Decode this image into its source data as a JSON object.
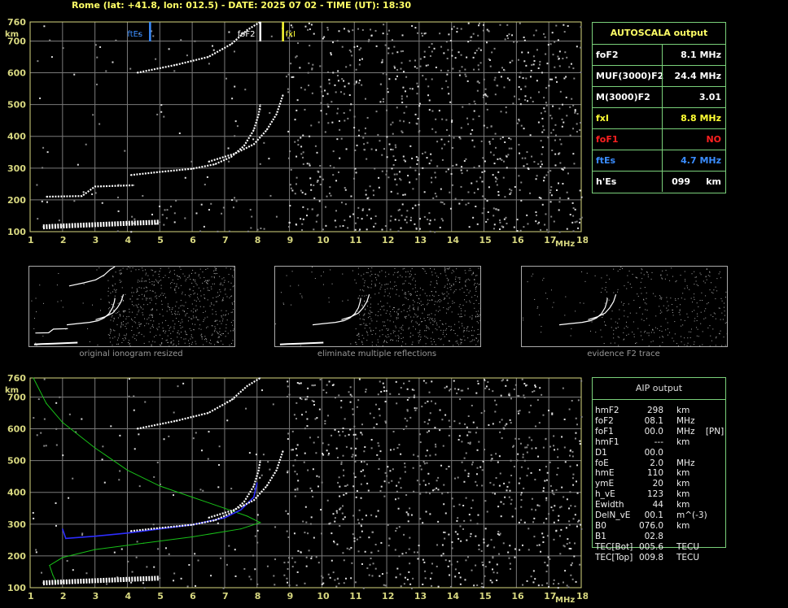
{
  "header": "Rome (lat: +41.8, lon: 012.5) - DATE: 2025 07 02 - TIME (UT): 18:30",
  "colors": {
    "grid": "#7a7a7a",
    "axis": "#d8d880",
    "trace": "#ffffff",
    "profile": "#18c018",
    "true_height": "#2d2dff",
    "fxI": "#ffff33",
    "ftEs": "#3a8dff",
    "foF1": "#ff2020",
    "table_border": "#7ad07a"
  },
  "chart_data": [
    {
      "type": "scatter",
      "title": "",
      "xlabel": "MHz",
      "ylabel": "km",
      "xlim": [
        1,
        18
      ],
      "ylim": [
        100,
        760
      ],
      "x_ticks": [
        "1",
        "2",
        "3",
        "4",
        "5",
        "6",
        "7",
        "8",
        "9",
        "10",
        "11",
        "12",
        "13",
        "14",
        "15",
        "16",
        "17",
        "18"
      ],
      "y_ticks": [
        "100",
        "200",
        "300",
        "400",
        "500",
        "600",
        "700",
        "760"
      ],
      "grid": true,
      "markers": [
        {
          "label": "ftEs",
          "x": 4.7,
          "color": "#3a8dff"
        },
        {
          "label": "foF2",
          "x": 8.1,
          "color": "#ffffff"
        },
        {
          "label": "fxI",
          "x": 8.8,
          "color": "#ffff33"
        }
      ],
      "series": [
        {
          "name": "",
          "role": "Es trace",
          "points": [
            [
              1.4,
              115
            ],
            [
              2,
              118
            ],
            [
              3,
              122
            ],
            [
              4,
              126
            ],
            [
              5,
              130
            ]
          ]
        },
        {
          "name": "",
          "role": "Es 2nd hop",
          "points": [
            [
              1.5,
              210
            ],
            [
              2.6,
              212
            ],
            [
              3,
              242
            ],
            [
              4.2,
              246
            ]
          ]
        },
        {
          "name": "",
          "role": "F2 ordinary",
          "points": [
            [
              4.1,
              278
            ],
            [
              5,
              288
            ],
            [
              6,
              298
            ],
            [
              6.7,
              312
            ],
            [
              7.2,
              335
            ],
            [
              7.6,
              370
            ],
            [
              7.9,
              420
            ],
            [
              8.05,
              470
            ],
            [
              8.1,
              500
            ]
          ]
        },
        {
          "name": "",
          "role": "F2 extraordinary",
          "points": [
            [
              6.5,
              320
            ],
            [
              7.3,
              345
            ],
            [
              7.9,
              375
            ],
            [
              8.3,
              420
            ],
            [
              8.6,
              470
            ],
            [
              8.8,
              530
            ]
          ]
        },
        {
          "name": "",
          "role": "F2 2nd hop",
          "points": [
            [
              4.3,
              600
            ],
            [
              5.5,
              625
            ],
            [
              6.5,
              650
            ],
            [
              7.2,
              690
            ],
            [
              7.7,
              735
            ],
            [
              8.1,
              760
            ]
          ]
        }
      ]
    },
    {
      "type": "line",
      "title": "",
      "xlabel": "MHz",
      "ylabel": "km",
      "xlim": [
        1,
        18
      ],
      "ylim": [
        100,
        760
      ],
      "x_ticks": [
        "1",
        "2",
        "3",
        "4",
        "5",
        "6",
        "7",
        "8",
        "9",
        "10",
        "11",
        "12",
        "13",
        "14",
        "15",
        "16",
        "17",
        "18"
      ],
      "y_ticks": [
        "100",
        "200",
        "300",
        "400",
        "500",
        "600",
        "700",
        "760"
      ],
      "grid": true,
      "series": [
        {
          "name": "",
          "role": "electron density profile",
          "points": [
            [
              1.1,
              760
            ],
            [
              1.5,
              680
            ],
            [
              2,
              620
            ],
            [
              3,
              540
            ],
            [
              4,
              470
            ],
            [
              5,
              420
            ],
            [
              6,
              385
            ],
            [
              7,
              350
            ],
            [
              7.7,
              325
            ],
            [
              8.1,
              305
            ],
            [
              7.5,
              285
            ],
            [
              6,
              260
            ],
            [
              4.5,
              240
            ],
            [
              3,
              220
            ],
            [
              2,
              195
            ],
            [
              1.6,
              170
            ],
            [
              1.7,
              140
            ],
            [
              1.8,
              118
            ]
          ]
        },
        {
          "name": "",
          "role": "true height profile",
          "points": [
            [
              2.0,
              285
            ],
            [
              2.1,
              255
            ],
            [
              3,
              262
            ],
            [
              4,
              272
            ],
            [
              5,
              285
            ],
            [
              6,
              298
            ],
            [
              7,
              320
            ],
            [
              7.5,
              345
            ],
            [
              7.9,
              385
            ],
            [
              8.0,
              430
            ]
          ]
        },
        {
          "name": "",
          "role": "F2 ordinary",
          "points": [
            [
              4.1,
              278
            ],
            [
              5,
              288
            ],
            [
              6,
              298
            ],
            [
              6.7,
              312
            ],
            [
              7.2,
              335
            ],
            [
              7.6,
              370
            ],
            [
              7.9,
              420
            ],
            [
              8.05,
              470
            ],
            [
              8.1,
              500
            ]
          ]
        },
        {
          "name": "",
          "role": "F2 extraordinary",
          "points": [
            [
              6.5,
              320
            ],
            [
              7.3,
              345
            ],
            [
              7.9,
              375
            ],
            [
              8.3,
              420
            ],
            [
              8.6,
              470
            ],
            [
              8.8,
              530
            ]
          ]
        },
        {
          "name": "",
          "role": "F2 2nd hop",
          "points": [
            [
              4.3,
              600
            ],
            [
              5.5,
              625
            ],
            [
              6.5,
              650
            ],
            [
              7.2,
              690
            ],
            [
              7.7,
              735
            ],
            [
              8.1,
              760
            ]
          ]
        },
        {
          "name": "",
          "role": "Es trace",
          "points": [
            [
              1.4,
              115
            ],
            [
              2,
              118
            ],
            [
              3,
              122
            ],
            [
              4,
              126
            ],
            [
              5,
              130
            ]
          ]
        }
      ]
    }
  ],
  "thumbnails": [
    {
      "caption": "original ionogram resized"
    },
    {
      "caption": "eliminate multiple reflections"
    },
    {
      "caption": "evidence F2 trace"
    }
  ],
  "autoscala": {
    "title": "AUTOSCALA output",
    "rows": [
      {
        "label": "foF2",
        "value": "8.1 MHz",
        "color": "#ffffff"
      },
      {
        "label": "MUF(3000)F2",
        "value": "24.4 MHz",
        "color": "#ffffff"
      },
      {
        "label": "M(3000)F2",
        "value": "3.01",
        "color": "#ffffff"
      },
      {
        "label": "fxI",
        "value": "8.8 MHz",
        "color": "#ffff33"
      },
      {
        "label": "foF1",
        "value": "NO",
        "color": "#ff2020"
      },
      {
        "label": "ftEs",
        "value": "4.7 MHz",
        "color": "#3a8dff"
      },
      {
        "label": "h'Es",
        "value": "099     km",
        "color": "#ffffff"
      }
    ]
  },
  "aip": {
    "title": "AIP output",
    "rows": [
      {
        "name": "hmF2",
        "value": "298",
        "unit": "km"
      },
      {
        "name": "foF2",
        "value": "08.1",
        "unit": "MHz"
      },
      {
        "name": "foF1",
        "value": "00.0",
        "unit": "MHz    [PN]"
      },
      {
        "name": "hmF1",
        "value": "---",
        "unit": "km"
      },
      {
        "name": "D1",
        "value": "00.0",
        "unit": ""
      },
      {
        "name": "foE",
        "value": "2.0",
        "unit": "MHz"
      },
      {
        "name": "hmE",
        "value": "110",
        "unit": "km"
      },
      {
        "name": "ymE",
        "value": "20",
        "unit": "km"
      },
      {
        "name": "h_vE",
        "value": "123",
        "unit": "km"
      },
      {
        "name": "Ewidth",
        "value": "44",
        "unit": "km"
      },
      {
        "name": "DelN_vE",
        "value": "00.1",
        "unit": "m^(-3)"
      },
      {
        "name": "B0",
        "value": "076.0",
        "unit": "km"
      },
      {
        "name": "B1",
        "value": "02.8",
        "unit": ""
      },
      {
        "name": "TEC[Bot]",
        "value": "005.6",
        "unit": "TECU"
      },
      {
        "name": "TEC[Top]",
        "value": "009.8",
        "unit": "TECU"
      }
    ]
  }
}
